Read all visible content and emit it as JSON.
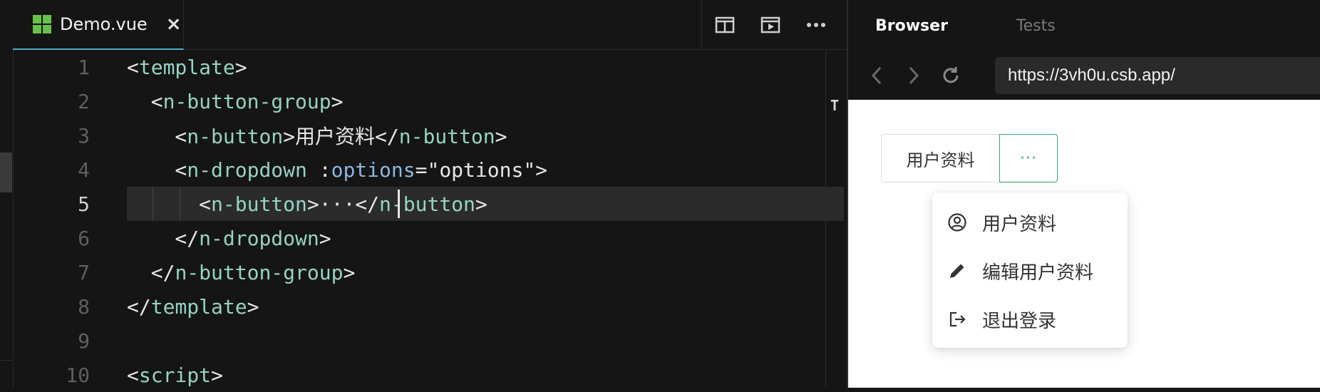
{
  "editor": {
    "tab": {
      "label": "Demo.vue",
      "close": "×"
    },
    "actions": [
      "split-editor-icon",
      "open-preview-icon",
      "more-actions-icon"
    ],
    "lines": [
      {
        "n": "1",
        "segs": [
          [
            "p",
            "<"
          ],
          [
            "t",
            "template"
          ],
          [
            "p",
            ">"
          ]
        ]
      },
      {
        "n": "2",
        "segs": [
          [
            "p",
            "  <"
          ],
          [
            "t",
            "n-button-group"
          ],
          [
            "p",
            ">"
          ]
        ]
      },
      {
        "n": "3",
        "segs": [
          [
            "p",
            "    <"
          ],
          [
            "t",
            "n-button"
          ],
          [
            "p",
            ">用户资料</"
          ],
          [
            "t",
            "n-button"
          ],
          [
            "p",
            ">"
          ]
        ]
      },
      {
        "n": "4",
        "segs": [
          [
            "p",
            "    <"
          ],
          [
            "t",
            "n-dropdown"
          ],
          [
            "p",
            " :"
          ],
          [
            "a",
            "options"
          ],
          [
            "p",
            "=\"options\">"
          ]
        ]
      },
      {
        "n": "5",
        "segs": [
          [
            "p",
            "      <"
          ],
          [
            "t",
            "n-button"
          ],
          [
            "p",
            ">···</"
          ],
          [
            "t",
            "n-button"
          ],
          [
            "p",
            ">"
          ]
        ]
      },
      {
        "n": "6",
        "segs": [
          [
            "p",
            "    </"
          ],
          [
            "t",
            "n-dropdown"
          ],
          [
            "p",
            ">"
          ]
        ]
      },
      {
        "n": "7",
        "segs": [
          [
            "p",
            "  </"
          ],
          [
            "t",
            "n-button-group"
          ],
          [
            "p",
            ">"
          ]
        ]
      },
      {
        "n": "8",
        "segs": [
          [
            "p",
            "</"
          ],
          [
            "t",
            "template"
          ],
          [
            "p",
            ">"
          ]
        ]
      },
      {
        "n": "9",
        "segs": []
      },
      {
        "n": "10",
        "segs": [
          [
            "p",
            "<"
          ],
          [
            "t",
            "script"
          ],
          [
            "p",
            ">"
          ]
        ]
      }
    ],
    "current_line": "5"
  },
  "preview": {
    "tabs": [
      "Browser",
      "Tests"
    ],
    "url": "https://3vh0u.csb.app/",
    "button_group": {
      "first": "用户资料",
      "more": "···"
    },
    "dropdown": [
      {
        "label": "用户资料",
        "icon": "user-circle-icon"
      },
      {
        "label": "编辑用户资料",
        "icon": "pencil-icon"
      },
      {
        "label": "退出登录",
        "icon": "logout-icon"
      }
    ]
  },
  "colors": {
    "tag": "#95d4c4",
    "attr": "#8ab7e0",
    "accent": "#35a46b",
    "tab_underline": "#4ab0c9"
  }
}
